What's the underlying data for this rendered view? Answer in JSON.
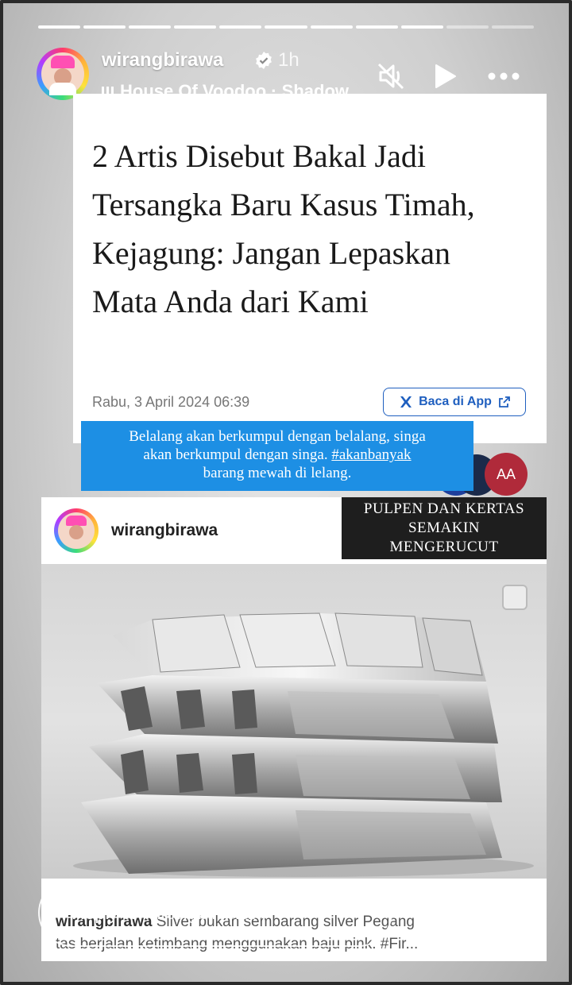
{
  "story": {
    "username": "wirangbirawa",
    "time_ago": "1h",
    "music_track": "House Of Voodoo · Shadow"
  },
  "article": {
    "headline": "2 Artis Disebut Bakal Jadi Tersangka Baru Kasus Timah, Kejagung: Jangan Lepaskan Mata Anda dari Kami",
    "date": "Rabu, 3 April 2024 06:39",
    "app_button_label": "Baca di App",
    "text_size_button": "AA"
  },
  "caption": {
    "line1": "Belalang akan berkumpul dengan belalang, singa",
    "line2_prefix": "akan berkumpul dengan singa. ",
    "hashtag": "#akanbanyak",
    "line3": "barang mewah di lelang."
  },
  "shared_post": {
    "username": "wirangbirawa",
    "caption_user": "wirangbirawa",
    "caption_line1": "Silver bukan sembarang silver Pegang",
    "caption_line2": "tas berjalan ketimbang menggunakan baju pink.  #Fir..."
  },
  "overlay_label": {
    "line1": "PULPEN DAN KERTAS",
    "line2": "SEMAKIN",
    "line3": "MENGERUCUT"
  },
  "reply": {
    "placeholder": "Reply to wirangbirawa..."
  },
  "colors": {
    "caption_bg": "#1d8fe4",
    "app_button": "#1f5fbf",
    "aa_button": "#b02a3a"
  },
  "icons": [
    "verified-icon",
    "mute-icon",
    "play-icon",
    "more-icon",
    "music-icon",
    "open-external-icon",
    "heart-icon",
    "send-icon"
  ]
}
